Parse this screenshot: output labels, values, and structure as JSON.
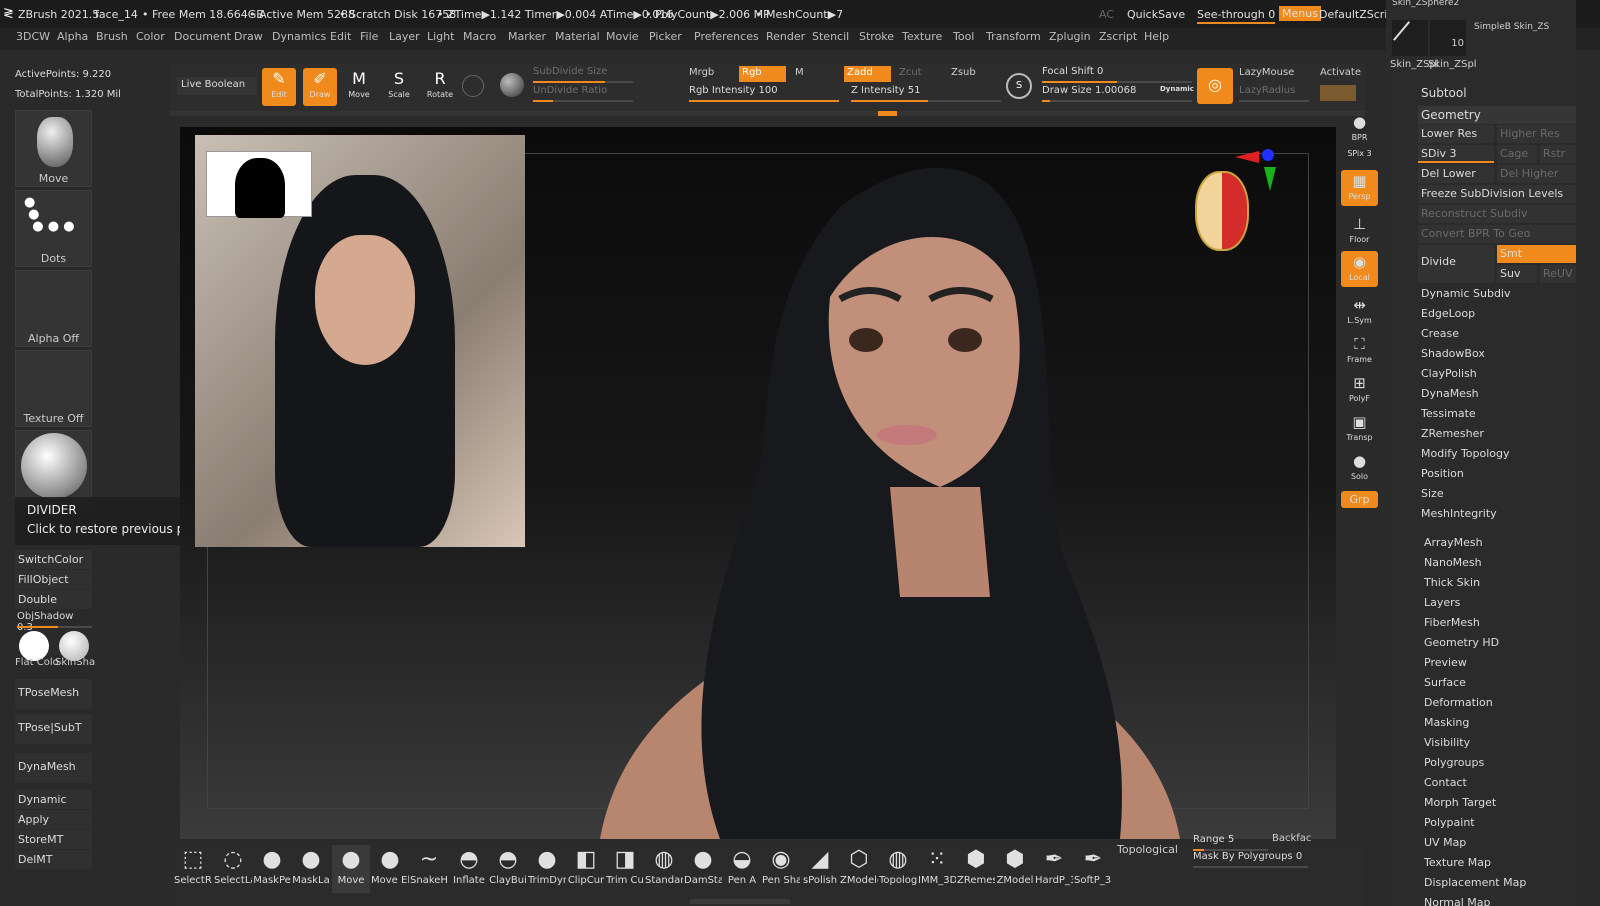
{
  "title_bar": {
    "app": "ZBrush 2021.5",
    "doc": "face_14",
    "free_mem": "• Free Mem 18.664GB",
    "active_mem": "• Active Mem 5288",
    "scratch": "• Scratch Disk 16758",
    "ztime": "• ZTime▶1.142 Timer▶0.004 ATime▶0.016",
    "polycount": "• PolyCount▶2.006 MP",
    "meshcount": "• MeshCount▶7",
    "ac": "AC",
    "quicksave": "QuickSave",
    "see_through": "See-through  0",
    "menus": "Menus",
    "script": "DefaultZScript"
  },
  "menus": [
    "3DCW",
    "Alpha",
    "Brush",
    "Color",
    "Document",
    "Draw",
    "Dynamics",
    "Edit",
    "File",
    "Layer",
    "Light",
    "Macro",
    "Marker",
    "Material",
    "Movie",
    "Picker",
    "Preferences",
    "Render",
    "Stencil",
    "Stroke",
    "Texture",
    "Tool",
    "Transform",
    "Zplugin",
    "Zscript",
    "Help"
  ],
  "stats": {
    "active_points": "ActivePoints: 9.220",
    "total_points": "TotalPoints: 1.320 Mil"
  },
  "shelf": {
    "live_boolean": "Live Boolean",
    "tools": [
      {
        "label": "Edit",
        "glyph": "✎",
        "active": true
      },
      {
        "label": "Draw",
        "glyph": "✐",
        "active": true
      },
      {
        "label": "Move",
        "glyph": "M",
        "active": false
      },
      {
        "label": "Scale",
        "glyph": "S",
        "active": false
      },
      {
        "label": "Rotate",
        "glyph": "R",
        "active": false
      }
    ],
    "subdivide_size": "SubDivide Size",
    "undivide_ratio": "UnDivide Ratio",
    "mrgb": "Mrgb",
    "rgb": "Rgb",
    "m": "M",
    "rgb_intensity": "Rgb Intensity 100",
    "zadd": "Zadd",
    "zcut": "Zcut",
    "zsub": "Zsub",
    "z_intensity": "Z Intensity 51",
    "focal_shift": "Focal Shift 0",
    "draw_size": "Draw Size 1.00068",
    "dynamic": "Dynamic",
    "lazymouse": "LazyMouse",
    "lazyradius": "LazyRadius",
    "activate": "Activate"
  },
  "left_panel": {
    "thumbs": [
      "Move",
      "Dots",
      "Alpha Off",
      "Texture Off"
    ],
    "tooltip_title": "DIVIDER",
    "tooltip_text": "Click to restore previous position.",
    "switch_color": "SwitchColor",
    "fill_object": "FillObject",
    "double": "Double",
    "obj_shadow": "ObjShadow 0.3",
    "flat_color": "Flat Colo",
    "skin_shade": "SkinSha",
    "tpose_mesh": "TPoseMesh",
    "tpose_subt": "TPose|SubT",
    "dynamesh": "DynaMesh",
    "dynamic": "Dynamic",
    "apply": "Apply",
    "store_mt": "StoreMT",
    "del_mt": "DelMT"
  },
  "right_icons": [
    {
      "label": "BPR",
      "active": false
    },
    {
      "label": "SPix 3",
      "active": false
    },
    {
      "label": "Persp",
      "active": true
    },
    {
      "label": "Floor",
      "active": false
    },
    {
      "label": "Local",
      "active": true
    },
    {
      "label": "L.Sym",
      "active": false
    },
    {
      "label": "Frame",
      "active": false
    },
    {
      "label": "PolyF",
      "active": false
    },
    {
      "label": "Transp",
      "active": false
    },
    {
      "label": "Solo",
      "active": false
    },
    {
      "label": "Grp",
      "active": true
    }
  ],
  "right_panel": {
    "thumb_a": "Skin_ZSpl",
    "thumb_b": "Skin_ZSpl",
    "thumb_count": "10",
    "top_a": "Skin_ZSphere2",
    "top_b": "SimpleB Skin_ZS",
    "subtool": "Subtool",
    "geometry": "Geometry",
    "lower_res": "Lower Res",
    "higher_res": "Higher Res",
    "sdiv": "SDiv 3",
    "cage": "Cage",
    "rstr": "Rstr",
    "del_lower": "Del Lower",
    "del_higher": "Del Higher",
    "freeze": "Freeze SubDivision Levels",
    "reconstruct": "Reconstruct Subdiv",
    "convert_bpr": "Convert BPR To Geo",
    "divide": "Divide",
    "smt": "Smt",
    "suv": "Suv",
    "reuv": "ReUV",
    "geometry_items": [
      "Dynamic Subdiv",
      "EdgeLoop",
      "Crease",
      "ShadowBox",
      "ClayPolish",
      "DynaMesh",
      "Tessimate",
      "ZRemesher",
      "Modify Topology",
      "Position",
      "Size",
      "MeshIntegrity"
    ],
    "sections": [
      "ArrayMesh",
      "NanoMesh",
      "Thick Skin",
      "Layers",
      "FiberMesh",
      "Geometry HD",
      "Preview",
      "Surface",
      "Deformation",
      "Masking",
      "Visibility",
      "Polygroups",
      "Contact",
      "Morph Target",
      "Polypaint",
      "UV Map",
      "Texture Map",
      "Displacement Map",
      "Normal Map"
    ]
  },
  "bottom_shelf": {
    "brushes": [
      "SelectRe",
      "SelectLa",
      "MaskPe",
      "MaskLa",
      "Move",
      "Move El",
      "SnakeHo",
      "Inflate",
      "ClayBui",
      "TrimDyn",
      "ClipCur",
      "Trim Cu",
      "Standar",
      "DamSta",
      "Pen A",
      "Pen Sha",
      "sPolish",
      "ZModele",
      "Topolog",
      "IMM_3D",
      "ZRemes",
      "ZModel",
      "HardP_3",
      "SoftP_3D"
    ],
    "topological": "Topological",
    "range": "Range 5",
    "backface": "Backfac",
    "mask_by_polygroups": "Mask By Polygroups 0"
  },
  "colors": {
    "accent": "#f08a1c",
    "panel": "#2b2b2b",
    "hair": "#1a1b1f",
    "skin": "#c2907a"
  }
}
